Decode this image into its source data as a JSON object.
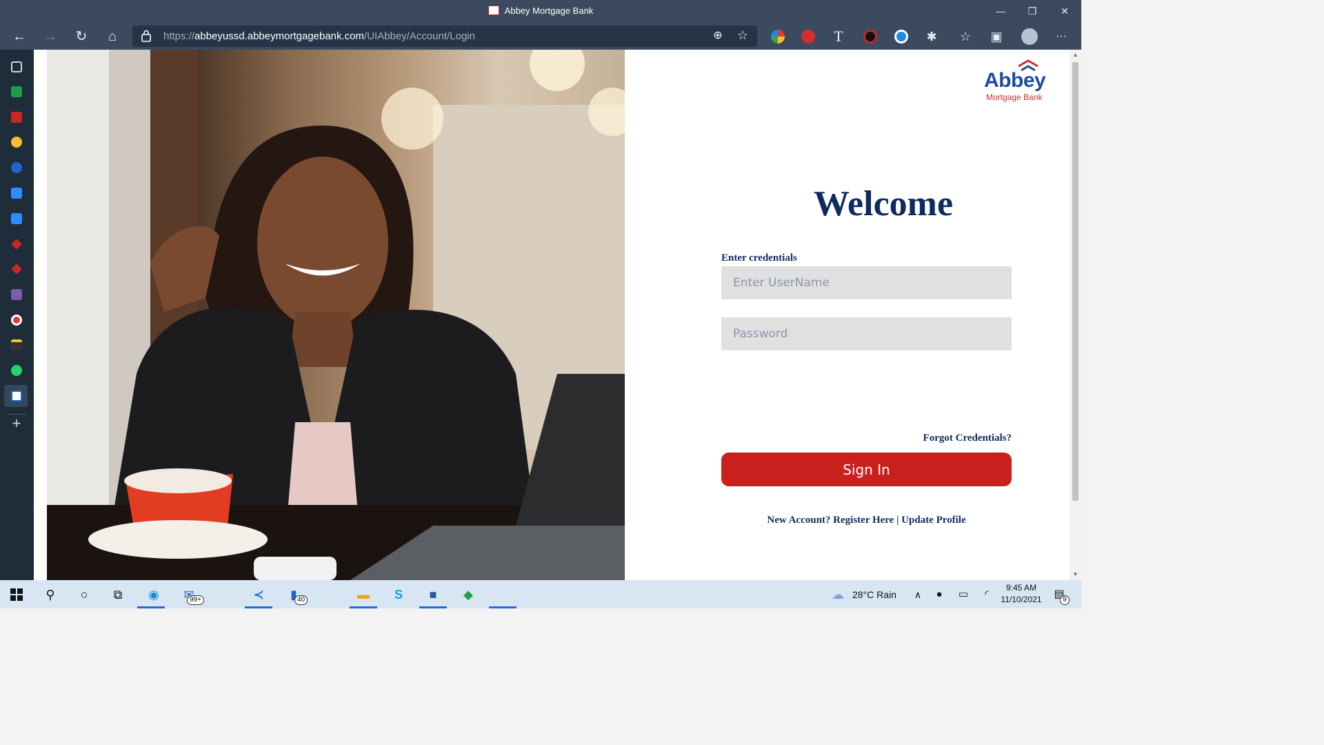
{
  "window": {
    "title": "Abbey Mortgage Bank",
    "controls": {
      "minimize": "—",
      "restore": "❐",
      "close": "✕"
    }
  },
  "browser": {
    "url_host_prefix": "https://",
    "url_host": "abbeyussd.abbeymortgagebank.com",
    "url_path": "/UIAbbey/Account/Login",
    "nav": {
      "back": "←",
      "forward": "→",
      "refresh": "↻",
      "home": "⌂"
    },
    "toolbar_icons": {
      "text": "T",
      "more": "···"
    }
  },
  "login": {
    "logo_word": "Abbey",
    "logo_sub": "Mortgage Bank",
    "welcome": "Welcome",
    "credentials_label": "Enter credentials",
    "username_placeholder": "Enter UserName",
    "password_placeholder": "Password",
    "forgot_link": "Forgot Credentials?",
    "signin_label": "Sign In",
    "register_link": "New Account? Register Here",
    "separator": "|",
    "update_link": "Update Profile"
  },
  "colors": {
    "navy": "#0f2a5c",
    "brand_red": "#c9201e",
    "logo_blue": "#1d4d9b",
    "input_bg": "#e0e0e0"
  },
  "taskbar": {
    "mail_badge": "99+",
    "files_badge": "40",
    "weather": "28°C  Rain",
    "time": "9:45 AM",
    "date": "11/10/2021",
    "notification_count": "9"
  }
}
